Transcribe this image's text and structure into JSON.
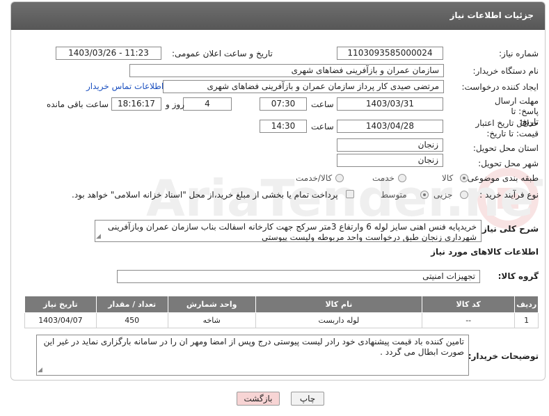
{
  "header": {
    "title": "جزئیات اطلاعات نیاز"
  },
  "fields": {
    "need_number": {
      "label": "شماره نیاز:",
      "value": "1103093585000024"
    },
    "announce_datetime": {
      "label": "تاریخ و ساعت اعلان عمومی:",
      "value": "1403/03/26 - 11:23"
    },
    "buyer_org": {
      "label": "نام دستگاه خریدار:",
      "value": "سازمان عمران و بازآفرینی فضاهای شهری"
    },
    "requester": {
      "label": "ایجاد کننده درخواست:",
      "value": "مرتضی  صیدی  کار پرداز سازمان عمران و بازآفرینی فضاهای شهری"
    },
    "contact_link": "اطلاعات تماس خریدار",
    "reply_deadline": {
      "label": "مهلت ارسال پاسخ: تا تاریخ:",
      "date": "1403/03/31",
      "time_label": "ساعت",
      "time": "07:30",
      "days": "4",
      "days_label": "روز و",
      "remaining": "18:16:17",
      "remaining_label": "ساعت باقی مانده"
    },
    "price_validity": {
      "label": "حداقل تاریخ اعتبار قیمت: تا تاریخ:",
      "date": "1403/04/28",
      "time_label": "ساعت",
      "time": "14:30"
    },
    "province": {
      "label": "استان محل تحویل:",
      "value": "زنجان"
    },
    "city": {
      "label": "شهر محل تحویل:",
      "value": "زنجان"
    },
    "category": {
      "label": "طبقه بندی موضوعی:",
      "options": [
        "کالا",
        "خدمت",
        "کالا/خدمت"
      ]
    },
    "process_type": {
      "label": "نوع فرآیند خرید :",
      "options": [
        "جزیی",
        "متوسط"
      ],
      "note": "پرداخت تمام یا بخشی از مبلغ خرید،از محل \"اسناد خزانه اسلامی\" خواهد بود."
    },
    "description": {
      "label": "شرح کلی نیاز:",
      "value": "خریدپایه فنس  اهنی سایز لوله 6 وارتفاع 3متر سرکج جهت کارخانه اسفالت بناب سازمان عمران وبازآفرینی شهرداری زنجان  طبق درخواست واحد مربوطه ولیست پیوستی"
    }
  },
  "goods_section": {
    "title": "اطلاعات کالاهای مورد نیاز",
    "group_label": "گروه کالا:",
    "group_value": "تجهیزات امنیتی",
    "columns": [
      "ردیف",
      "کد کالا",
      "نام کالا",
      "واحد شمارش",
      "تعداد / مقدار",
      "تاریخ نیاز"
    ],
    "rows": [
      [
        "1",
        "--",
        "لوله داربست",
        "شاخه",
        "450",
        "1403/04/07"
      ]
    ]
  },
  "buyer_notes": {
    "label": "توضیحات خریدار:",
    "value": "تامین کننده باد قیمت پیشنهادی خود رادر لیست پیوستی درج وپس از امضا ومهر ان را در سامانه بارگزاری نماید در غیر این صورت ابطال می گردد ."
  },
  "buttons": {
    "print": "چاپ",
    "back": "بازگشت"
  },
  "colors": {
    "header": "#5f5f5f",
    "link": "#1a4fbf",
    "back_button": "#f7d4d4"
  }
}
